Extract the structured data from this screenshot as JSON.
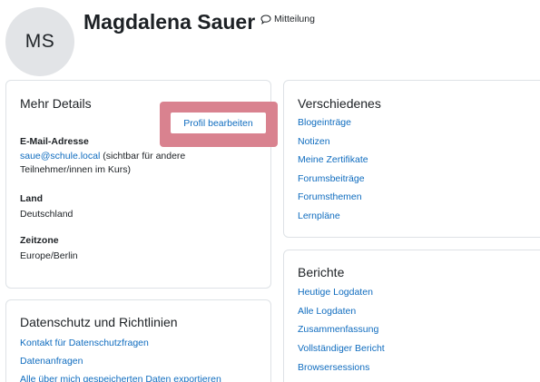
{
  "profile": {
    "initials": "MS",
    "name": "Magdalena Sauer",
    "message_label": "Mitteilung"
  },
  "details": {
    "title": "Mehr Details",
    "edit_label": "Profil bearbeiten",
    "email_label": "E-Mail-Adresse",
    "email_value": "saue@schule.local",
    "email_note_1": " (sichtbar für andere",
    "email_note_2": "Teilnehmer/innen im Kurs)",
    "country_label": "Land",
    "country_value": "Deutschland",
    "timezone_label": "Zeitzone",
    "timezone_value": "Europe/Berlin"
  },
  "privacy": {
    "title": "Datenschutz und Richtlinien",
    "links": [
      "Kontakt für Datenschutzfragen",
      "Datenanfragen",
      "Alle über mich gespeicherten Daten exportieren"
    ]
  },
  "misc": {
    "title": "Verschiedenes",
    "links": [
      "Blogeinträge",
      "Notizen",
      "Meine Zertifikate",
      "Forumsbeiträge",
      "Forumsthemen",
      "Lernpläne"
    ]
  },
  "reports": {
    "title": "Berichte",
    "links": [
      "Heutige Logdaten",
      "Alle Logdaten",
      "Zusammenfassung",
      "Vollständiger Bericht",
      "Browsersessions"
    ]
  },
  "colors": {
    "link": "#0f6cbf",
    "highlight": "#d9828f",
    "avatar_bg": "#e2e4e7"
  },
  "icons": {
    "message": "speech-bubble-icon"
  }
}
